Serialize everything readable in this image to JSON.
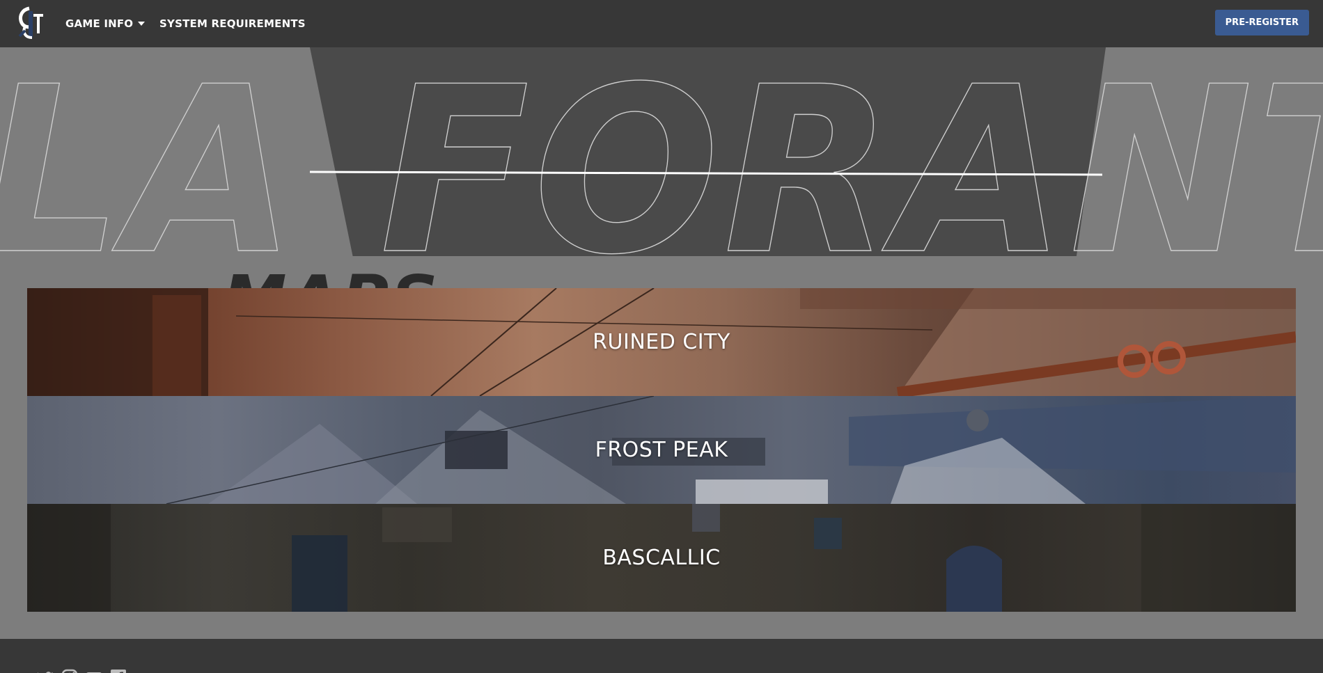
{
  "nav": {
    "game_info": "GAME INFO",
    "system_requirements": "SYSTEM REQUIREMENTS",
    "pre_register": "PRE-REGISTER"
  },
  "hero": {
    "wordmark": "LA FORANT",
    "section_heading": "MAPS"
  },
  "maps": [
    {
      "name": "RUINED CITY"
    },
    {
      "name": "FROST PEAK"
    },
    {
      "name": "BASCALLIC"
    }
  ],
  "footer": {
    "social": [
      "twitter-icon",
      "instagram-icon",
      "youtube-icon",
      "facebook-icon"
    ]
  },
  "colors": {
    "nav_bg": "#373737",
    "page_bg": "#7d7d7d",
    "hero_panel": "#4a4a4a",
    "accent_button": "#3a5b92"
  }
}
